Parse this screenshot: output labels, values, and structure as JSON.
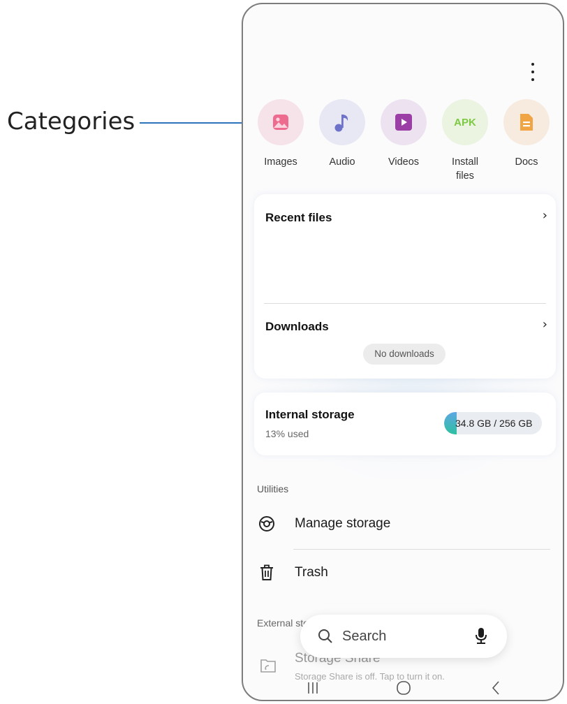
{
  "callout": {
    "label": "Categories"
  },
  "categories": [
    {
      "label": "Images",
      "icon": "image-icon",
      "bg": "#f6e3ea",
      "color": "#ec5f86"
    },
    {
      "label": "Audio",
      "icon": "music-note-icon",
      "bg": "#e7e8f4",
      "color": "#6e73c9"
    },
    {
      "label": "Videos",
      "icon": "play-icon",
      "bg": "#ede3f0",
      "color": "#9b3fa6"
    },
    {
      "label": "Install\nfiles",
      "icon": "apk-icon",
      "icon_text": "APK",
      "bg": "#eaf4e1",
      "color": "#7ec944"
    },
    {
      "label": "Docs",
      "icon": "document-icon",
      "bg": "#f7ebdf",
      "color": "#f0a444"
    }
  ],
  "recent": {
    "title": "Recent files",
    "chevron": "›"
  },
  "downloads": {
    "title": "Downloads",
    "chevron": "›",
    "empty": "No downloads"
  },
  "storage": {
    "title": "Internal storage",
    "sub": "13% used",
    "used": "34.8 GB",
    "sep": " / ",
    "total": "256 GB",
    "fraction": 0.13
  },
  "utilities": {
    "title": "Utilities",
    "items": [
      {
        "label": "Manage storage",
        "icon": "storage-gauge-icon"
      },
      {
        "label": "Trash",
        "icon": "trash-icon"
      }
    ]
  },
  "external": {
    "title": "External storage",
    "item": {
      "title": "Storage Share",
      "sub": "Storage Share is off. Tap to turn it on.",
      "icon": "storage-share-icon"
    }
  },
  "search": {
    "placeholder": "Search",
    "icon": "search-icon",
    "mic_icon": "mic-icon"
  },
  "nav": {
    "recents": "recents-icon",
    "home": "home-icon",
    "back": "back-icon"
  },
  "colors": {
    "accent_line": "#2a73b8",
    "phone_bg": "#fbfbfc"
  }
}
